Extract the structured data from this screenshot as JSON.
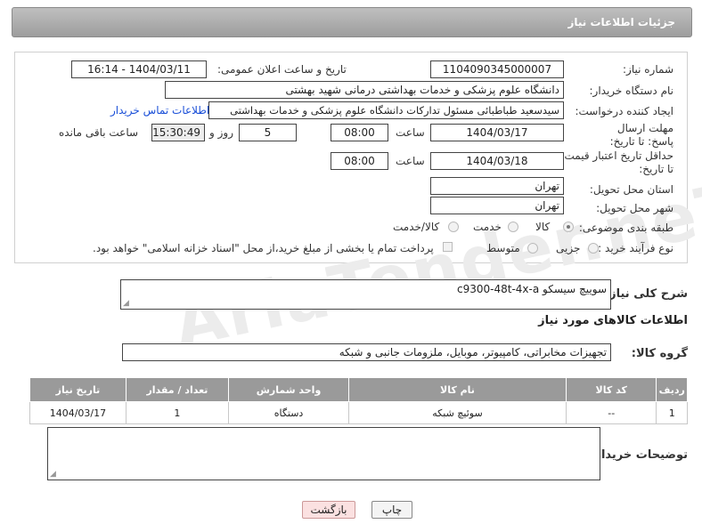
{
  "header": {
    "title": "جزئیات اطلاعات نیاز"
  },
  "form": {
    "need_number_label": "شماره نیاز:",
    "need_number": "1104090345000007",
    "announce_label": "تاریخ و ساعت اعلان عمومی:",
    "announce_value": "1404/03/11 - 16:14",
    "buyer_org_label": "نام دستگاه خریدار:",
    "buyer_org": "دانشگاه علوم پزشکی و خدمات بهداشتی درمانی شهید بهشتی",
    "requester_label": "ایجاد کننده درخواست:",
    "requester": "سیدسعید طباطبائی مسئول تدارکات دانشگاه علوم پزشکی و خدمات بهداشتی",
    "contact_link": "اطلاعات تماس خریدار",
    "reply_deadline_label": "مهلت ارسال پاسخ: تا تاریخ:",
    "reply_date": "1404/03/17",
    "time_label": "ساعت",
    "reply_time": "08:00",
    "days_value": "5",
    "days_label": "روز و",
    "remaining_time": "15:30:49",
    "remaining_label": "ساعت باقی مانده",
    "price_deadline_label": "حداقل تاریخ اعتبار قیمت: تا تاریخ:",
    "price_date": "1404/03/18",
    "price_time": "08:00",
    "province_label": "استان محل تحویل:",
    "province": "تهران",
    "city_label": "شهر محل تحویل:",
    "city": "تهران",
    "category_label": "طبقه بندی موضوعی:",
    "category_options": [
      "کالا",
      "خدمت",
      "کالا/خدمت"
    ],
    "process_label": "نوع فرآیند خرید :",
    "process_options": [
      "جزیی",
      "متوسط"
    ],
    "payment_note": "پرداخت تمام یا بخشی از مبلغ خرید،از محل \"اسناد خزانه اسلامی\" خواهد بود."
  },
  "description": {
    "label": "شرح کلی نیاز:",
    "value": "سوییچ سیسکو c9300-48t-4x-a"
  },
  "goods_section": {
    "title": "اطلاعات کالاهای مورد نیاز",
    "group_label": "گروه کالا:",
    "group_value": "تجهیزات مخابراتی، کامپیوتر، موبایل، ملزومات جانبی و شبکه"
  },
  "table": {
    "headers": [
      "ردیف",
      "کد کالا",
      "نام کالا",
      "واحد شمارش",
      "تعداد / مقدار",
      "تاریخ نیاز"
    ],
    "rows": [
      [
        "1",
        "--",
        "سوئیچ شبکه",
        "دستگاه",
        "1",
        "1404/03/17"
      ]
    ]
  },
  "buyer_notes": {
    "label": "توضیحات خریدار:"
  },
  "buttons": {
    "print": "چاپ",
    "back": "بازگشت"
  },
  "watermark_text": "AriaTender.neT"
}
